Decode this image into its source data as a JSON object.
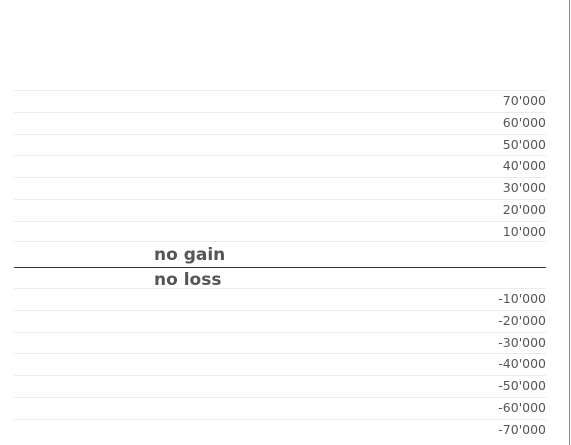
{
  "chart_data": {
    "type": "bar",
    "title": "",
    "xlabel": "",
    "ylabel": "",
    "ylim": [
      -70000,
      70000
    ],
    "grid": true,
    "y_ticks": [
      {
        "value": 70000,
        "label": "70'000"
      },
      {
        "value": 60000,
        "label": "60'000"
      },
      {
        "value": 50000,
        "label": "50'000"
      },
      {
        "value": 40000,
        "label": "40'000"
      },
      {
        "value": 30000,
        "label": "30'000"
      },
      {
        "value": 20000,
        "label": "20'000"
      },
      {
        "value": 10000,
        "label": "10'000"
      },
      {
        "value": -10000,
        "label": "-10'000"
      },
      {
        "value": -20000,
        "label": "-20'000"
      },
      {
        "value": -30000,
        "label": "-30'000"
      },
      {
        "value": -40000,
        "label": "-40'000"
      },
      {
        "value": -50000,
        "label": "-50'000"
      },
      {
        "value": -60000,
        "label": "-60'000"
      },
      {
        "value": -70000,
        "label": "-70'000"
      }
    ],
    "zero_line": {
      "above_label": "no gain",
      "below_label": "no loss"
    },
    "series": []
  }
}
